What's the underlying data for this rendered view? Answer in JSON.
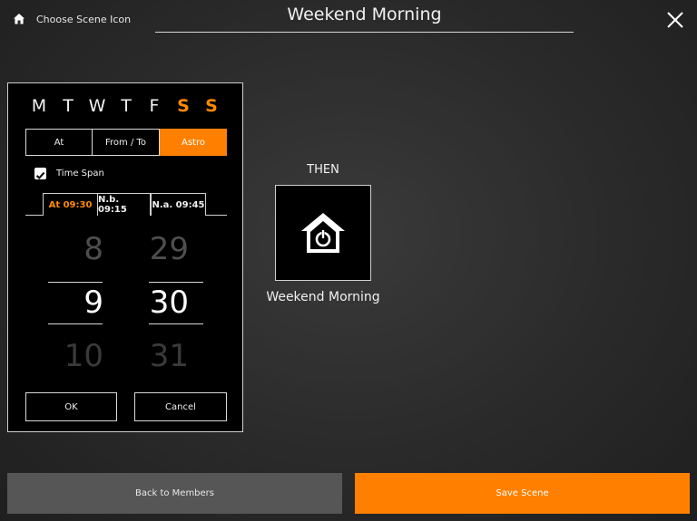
{
  "header": {
    "choose_icon_label": "Choose Scene Icon",
    "title": "Weekend Morning",
    "close_icon": "close-icon",
    "home_icon": "home-icon"
  },
  "schedule": {
    "days": [
      {
        "label": "M",
        "active": false
      },
      {
        "label": "T",
        "active": false
      },
      {
        "label": "W",
        "active": false
      },
      {
        "label": "T",
        "active": false
      },
      {
        "label": "F",
        "active": false
      },
      {
        "label": "S",
        "active": true
      },
      {
        "label": "S",
        "active": true
      }
    ],
    "modes": [
      "At",
      "From / To",
      "Astro"
    ],
    "selected_mode": "Astro",
    "time_span": {
      "label": "Time Span",
      "checked": true
    },
    "tabs": [
      "At 09:30",
      "N.b. 09:15",
      "N.a. 09:45"
    ],
    "selected_tab": "At 09:30",
    "hour_picker": {
      "prev": "8",
      "selected": "9",
      "next": "10"
    },
    "minute_picker": {
      "prev": "29",
      "selected": "30",
      "next": "31"
    },
    "ok_label": "OK",
    "cancel_label": "Cancel"
  },
  "then": {
    "label": "THEN",
    "scene_icon": "home-power-icon",
    "scene_name": "Weekend Morning"
  },
  "footer": {
    "back_label": "Back to Members",
    "save_label": "Save Scene"
  },
  "colors": {
    "accent": "#ff8000",
    "panel_bg": "#000000",
    "back_button_bg": "#565656"
  }
}
